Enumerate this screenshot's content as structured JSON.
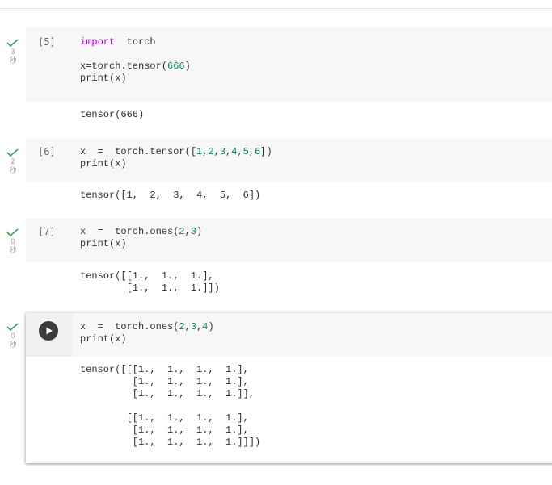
{
  "cells": [
    {
      "exec_count": "[5]",
      "duration": "3",
      "unit": "秒",
      "code": [
        {
          "t": "import",
          "c": "kw"
        },
        {
          "t": "  torch\n\nx=torch.tensor("
        },
        {
          "t": "666",
          "c": "num"
        },
        {
          "t": ")\nprint(x)"
        }
      ],
      "output": "tensor(666)"
    },
    {
      "exec_count": "[6]",
      "duration": "2",
      "unit": "秒",
      "code": [
        {
          "t": "x  =  torch.tensor(["
        },
        {
          "t": "1",
          "c": "num"
        },
        {
          "t": ","
        },
        {
          "t": "2",
          "c": "num"
        },
        {
          "t": ","
        },
        {
          "t": "3",
          "c": "num"
        },
        {
          "t": ","
        },
        {
          "t": "4",
          "c": "num"
        },
        {
          "t": ","
        },
        {
          "t": "5",
          "c": "num"
        },
        {
          "t": ","
        },
        {
          "t": "6",
          "c": "num"
        },
        {
          "t": "])\nprint(x)"
        }
      ],
      "output": "tensor([1,  2,  3,  4,  5,  6])"
    },
    {
      "exec_count": "[7]",
      "duration": "0",
      "unit": "秒",
      "code": [
        {
          "t": "x  =  torch.ones("
        },
        {
          "t": "2",
          "c": "num"
        },
        {
          "t": ","
        },
        {
          "t": "3",
          "c": "num"
        },
        {
          "t": ")\nprint(x)"
        }
      ],
      "output": "tensor([[1.,  1.,  1.],\n        [1.,  1.,  1.]])"
    },
    {
      "exec_count": "",
      "duration": "0",
      "unit": "秒",
      "code": [
        {
          "t": "x  =  torch.ones("
        },
        {
          "t": "2",
          "c": "num"
        },
        {
          "t": ","
        },
        {
          "t": "3",
          "c": "num"
        },
        {
          "t": ","
        },
        {
          "t": "4",
          "c": "num"
        },
        {
          "t": ")\nprint(x)"
        }
      ],
      "output": "tensor([[[1.,  1.,  1.,  1.],\n         [1.,  1.,  1.,  1.],\n         [1.,  1.,  1.,  1.]],\n\n        [[1.,  1.,  1.,  1.],\n         [1.,  1.,  1.,  1.],\n         [1.,  1.,  1.,  1.]]])"
    }
  ],
  "colors": {
    "success_check": "#34a853",
    "keyword": "#af00db",
    "number": "#098658",
    "run_button": "#3c3c3c"
  },
  "icons": {
    "status": "check-icon",
    "run": "play-icon"
  }
}
